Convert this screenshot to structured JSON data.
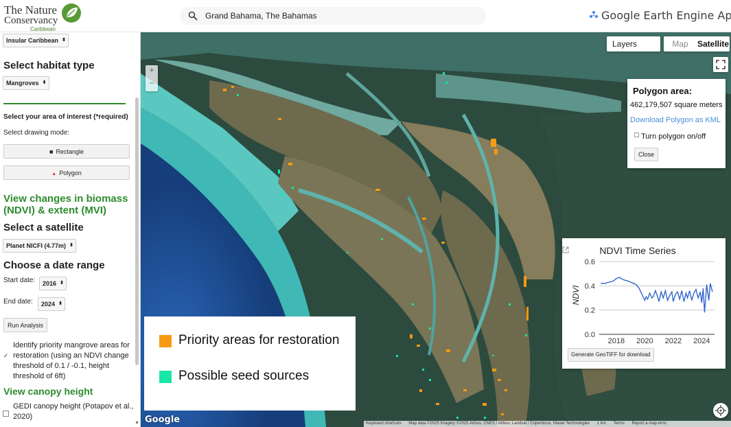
{
  "header": {
    "logo_line1": "The Nature",
    "logo_line2": "Conservancy",
    "logo_line3": "Caribbean",
    "search_value": "Grand Bahama, The Bahamas",
    "brand": "Google Earth Engine Apps",
    "icons": [
      "leaf-icon",
      "search-icon",
      "earth-engine-icon"
    ]
  },
  "sidebar": {
    "region_select": "Insular Caribbean",
    "habitat_heading": "Select habitat type",
    "habitat_select": "Mangroves",
    "aoi_heading": "Select your area of interest (*required)",
    "drawing_mode_label": "Select drawing mode:",
    "rectangle_button": "Rectangle",
    "polygon_button": "Polygon",
    "biomass_heading": "View changes in biomass (NDVI) & extent (MVI)",
    "satellite_heading": "Select a satellite",
    "satellite_select": "Planet NICFI (4.77m)",
    "date_heading": "Choose a date range",
    "start_label": "Start date:",
    "start_value": "2016",
    "end_label": "End date:",
    "end_value": "2024",
    "run_button": "Run Analysis",
    "priority_checkbox": "Identify priority mangrove areas for restoration (using an NDVI change threshold of 0.1 / -0.1, height threshold of 6ft)",
    "priority_checked": true,
    "canopy_heading": "View canopy height",
    "gedi_checkbox": "GEDI canopy height (Potapov et al., 2020)",
    "gedi_checked": false
  },
  "map": {
    "layers_label": "Layers",
    "map_type_map": "Map",
    "map_type_satellite": "Satellite",
    "map_type_selected": "Satellite",
    "zoom_in": "+",
    "zoom_out": "−",
    "google_watermark": "Google",
    "attribution": {
      "shortcuts": "Keyboard shortcuts",
      "data": "Map data ©2025 Imagery ©2025 Airbus, CNES / Airbus, Landsat / Copernicus, Maxar Technologies",
      "scale": "1 km",
      "terms": "Terms",
      "report": "Report a map error"
    },
    "colors": {
      "priority": "#f59a12",
      "seed": "#19e6a8",
      "deep_water": "#1f4e8e",
      "shallow_water": "#3fb8b6"
    }
  },
  "polygon_panel": {
    "title": "Polygon area:",
    "value": "462,179,507 square meters",
    "download_link": "Download Polygon as KML",
    "toggle_label": "Turn polygon on/off",
    "close_button": "Close"
  },
  "legend": {
    "items": [
      {
        "label": "Priority areas for restoration",
        "color": "#f59a12"
      },
      {
        "label": "Possible seed sources",
        "color": "#19e6a8"
      }
    ]
  },
  "ndvi_panel": {
    "generate_button": "Generate GeoTIFF for download",
    "chart_data": {
      "type": "line",
      "title": "NDVI Time Series",
      "xlabel": "",
      "ylabel": "NDVI",
      "xlim": [
        2016.8,
        2024.9
      ],
      "ylim": [
        0.0,
        0.6
      ],
      "yticks": [
        0.0,
        0.2,
        0.4,
        0.6
      ],
      "xticks": [
        2018,
        2020,
        2022,
        2024
      ],
      "grid": true,
      "color": "#3366cc",
      "x": [
        2016.9,
        2017.2,
        2017.5,
        2017.8,
        2018.0,
        2018.2,
        2018.5,
        2018.8,
        2019.0,
        2019.2,
        2019.4,
        2019.6,
        2019.8,
        2020.0,
        2020.1,
        2020.2,
        2020.35,
        2020.5,
        2020.6,
        2020.75,
        2020.9,
        2021.0,
        2021.15,
        2021.3,
        2021.45,
        2021.6,
        2021.75,
        2021.9,
        2022.0,
        2022.15,
        2022.3,
        2022.45,
        2022.6,
        2022.75,
        2022.9,
        2023.0,
        2023.15,
        2023.3,
        2023.45,
        2023.6,
        2023.75,
        2023.9,
        2024.0,
        2024.1,
        2024.2,
        2024.35,
        2024.5,
        2024.6,
        2024.75
      ],
      "values": [
        0.42,
        0.42,
        0.43,
        0.44,
        0.46,
        0.47,
        0.45,
        0.44,
        0.43,
        0.42,
        0.41,
        0.38,
        0.33,
        0.28,
        0.31,
        0.29,
        0.34,
        0.3,
        0.31,
        0.36,
        0.31,
        0.27,
        0.35,
        0.3,
        0.36,
        0.28,
        0.32,
        0.35,
        0.27,
        0.33,
        0.35,
        0.29,
        0.36,
        0.27,
        0.34,
        0.3,
        0.36,
        0.28,
        0.34,
        0.37,
        0.3,
        0.35,
        0.26,
        0.38,
        0.18,
        0.41,
        0.28,
        0.42,
        0.35
      ]
    }
  }
}
